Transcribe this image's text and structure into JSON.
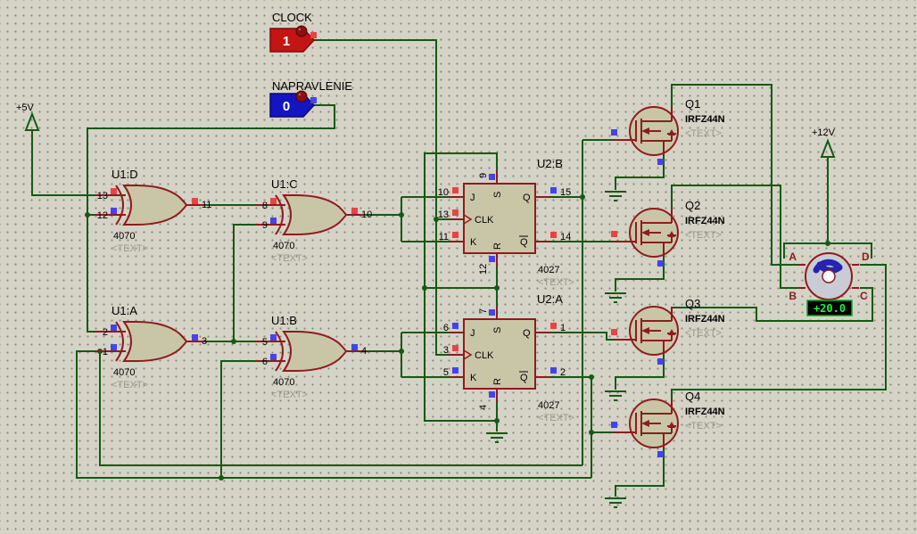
{
  "schematic": {
    "power": {
      "v5_label": "+5V",
      "v12_label": "+12V"
    },
    "inputs": {
      "clock": {
        "label": "CLOCK",
        "value": "1"
      },
      "direction": {
        "label": "NAPRAVLENIE",
        "value": "0"
      }
    },
    "gates": {
      "u1d": {
        "ref": "U1:D",
        "part": "4070",
        "text_placeholder": "<TEXT>",
        "pin_in1": "13",
        "pin_in2": "12",
        "pin_out": "11"
      },
      "u1c": {
        "ref": "U1:C",
        "part": "4070",
        "text_placeholder": "<TEXT>",
        "pin_in1": "8",
        "pin_in2": "9",
        "pin_out": "10"
      },
      "u1a": {
        "ref": "U1:A",
        "part": "4070",
        "text_placeholder": "<TEXT>",
        "pin_in1": "2",
        "pin_in2": "1",
        "pin_out": "3"
      },
      "u1b": {
        "ref": "U1:B",
        "part": "4070",
        "text_placeholder": "<TEXT>",
        "pin_in1": "5",
        "pin_in2": "6",
        "pin_out": "4"
      }
    },
    "flipflops": {
      "u2b": {
        "ref": "U2:B",
        "part": "4027",
        "text_placeholder": "<TEXT>",
        "lbl_j": "J",
        "lbl_clk": "CLK",
        "lbl_k": "K",
        "lbl_s": "S",
        "lbl_r": "R",
        "lbl_q": "Q",
        "lbl_qb": "Q",
        "pin_j": "10",
        "pin_clk": "13",
        "pin_k": "11",
        "pin_s": "9",
        "pin_r": "12",
        "pin_q": "15",
        "pin_qb": "14"
      },
      "u2a": {
        "ref": "U2:A",
        "part": "4027",
        "text_placeholder": "<TEXT>",
        "lbl_j": "J",
        "lbl_clk": "CLK",
        "lbl_k": "K",
        "lbl_s": "S",
        "lbl_r": "R",
        "lbl_q": "Q",
        "lbl_qb": "Q",
        "pin_j": "6",
        "pin_clk": "3",
        "pin_k": "5",
        "pin_s": "7",
        "pin_r": "4",
        "pin_q": "1",
        "pin_qb": "2"
      }
    },
    "mosfets": {
      "q1": {
        "ref": "Q1",
        "part": "IRFZ44N",
        "text_placeholder": "<TEXT>"
      },
      "q2": {
        "ref": "Q2",
        "part": "IRFZ44N",
        "text_placeholder": "<TEXT>"
      },
      "q3": {
        "ref": "Q3",
        "part": "IRFZ44N",
        "text_placeholder": "<TEXT>"
      },
      "q4": {
        "ref": "Q4",
        "part": "IRFZ44N",
        "text_placeholder": "<TEXT>"
      }
    },
    "motor": {
      "terminal_a": "A",
      "terminal_b": "B",
      "terminal_c": "C",
      "terminal_d": "D",
      "display_value": "+20.0"
    },
    "colors": {
      "background": "#d5d2c6",
      "wire": "#155a15",
      "component_outline": "#8e1c1c",
      "component_fill": "#c9c6a8",
      "state_high": "#e84444",
      "state_low": "#4444e8",
      "clock_box": "#c41414",
      "direction_box": "#1414c0",
      "display_text": "#22ee44"
    }
  }
}
